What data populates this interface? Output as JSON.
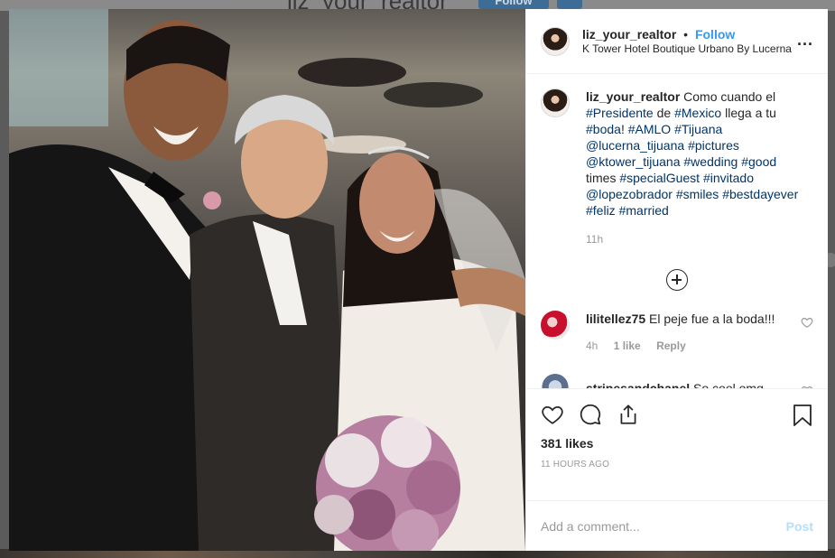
{
  "background": {
    "handle": "liz_your_realtor",
    "follow_label": "Follow"
  },
  "post": {
    "photo_alt": "Wedding photo",
    "header": {
      "username": "liz_your_realtor",
      "separator": "•",
      "follow_label": "Follow",
      "location": "K Tower Hotel Boutique Urbano By Lucerna",
      "more_label": "..."
    },
    "caption": {
      "username": "liz_your_realtor",
      "segments": [
        {
          "text": "Como cuando el ",
          "tag": false
        },
        {
          "text": "#Presidente",
          "tag": true
        },
        {
          "text": " de ",
          "tag": false
        },
        {
          "text": "#Mexico",
          "tag": true
        },
        {
          "text": " llega a tu ",
          "tag": false
        },
        {
          "text": "#boda",
          "tag": true
        },
        {
          "text": "! ",
          "tag": false
        },
        {
          "text": "#AMLO",
          "tag": true
        },
        {
          "text": " ",
          "tag": false
        },
        {
          "text": "#Tijuana",
          "tag": true
        },
        {
          "text": " ",
          "tag": false
        },
        {
          "text": "@lucerna_tijuana",
          "tag": true
        },
        {
          "text": " ",
          "tag": false
        },
        {
          "text": "#pictures",
          "tag": true
        },
        {
          "text": " ",
          "tag": false
        },
        {
          "text": "@ktower_tijuana",
          "tag": true
        },
        {
          "text": " ",
          "tag": false
        },
        {
          "text": "#wedding",
          "tag": true
        },
        {
          "text": " ",
          "tag": false
        },
        {
          "text": "#good",
          "tag": true
        },
        {
          "text": " times ",
          "tag": false
        },
        {
          "text": "#specialGuest",
          "tag": true
        },
        {
          "text": " ",
          "tag": false
        },
        {
          "text": "#invitado",
          "tag": true
        },
        {
          "text": " ",
          "tag": false
        },
        {
          "text": "@lopezobrador",
          "tag": true
        },
        {
          "text": " ",
          "tag": false
        },
        {
          "text": "#smiles",
          "tag": true
        },
        {
          "text": " ",
          "tag": false
        },
        {
          "text": "#bestdayever",
          "tag": true
        },
        {
          "text": " ",
          "tag": false
        },
        {
          "text": "#feliz",
          "tag": true
        },
        {
          "text": " ",
          "tag": false
        },
        {
          "text": "#married",
          "tag": true
        }
      ],
      "time": "11h"
    },
    "comments": [
      {
        "username": "lilitellez75",
        "text": "El peje fue a la boda!!!",
        "time": "4h",
        "likes": "1 like",
        "reply": "Reply"
      },
      {
        "username": "stripesandchanel",
        "text": "So cool omg"
      }
    ],
    "likes": "381 likes",
    "posted": "11 HOURS AGO",
    "add_comment_placeholder": "Add a comment...",
    "post_label": "Post"
  },
  "colors": {
    "link": "#3897f0",
    "tag": "#003569",
    "muted": "#999999",
    "post_disabled": "#b2dffc"
  },
  "icons": [
    "heart-icon",
    "comment-icon",
    "share-icon",
    "bookmark-icon",
    "more-icon",
    "plus-circle-icon"
  ]
}
